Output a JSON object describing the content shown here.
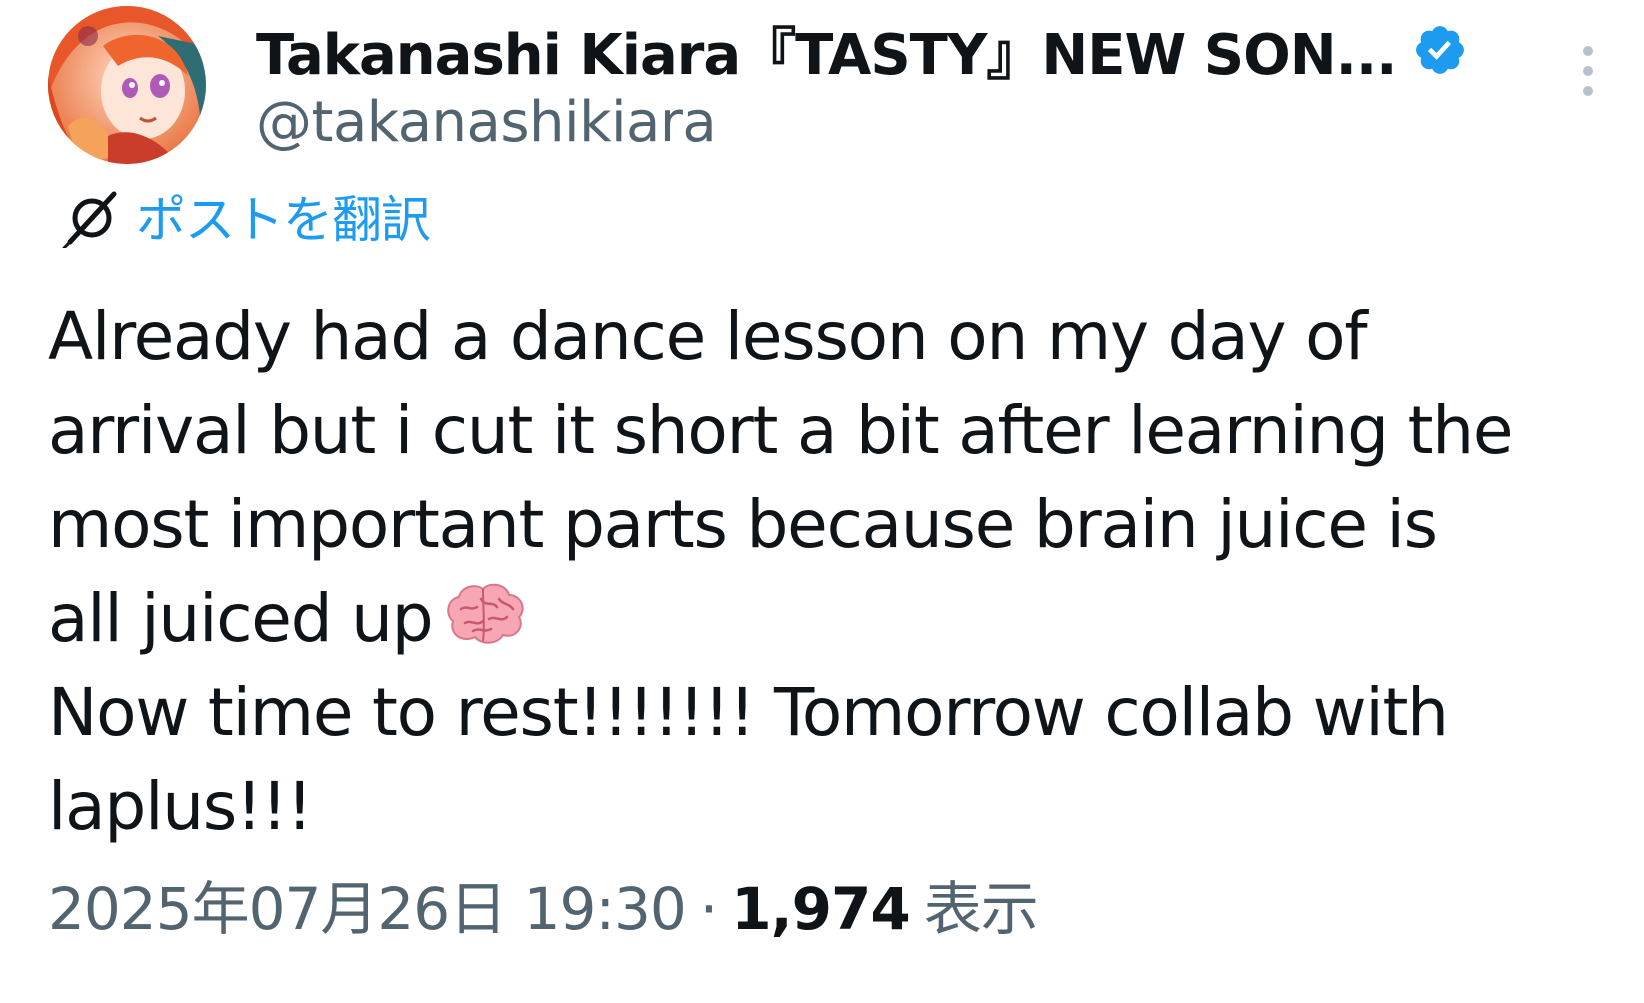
{
  "post": {
    "author": {
      "display_name": "Takanashi Kiara『TASTY』NEW SON...",
      "handle": "@takanashikiara",
      "verified_icon": "verified-badge-icon",
      "avatar": "avatar"
    },
    "more_icon": "more-vertical-icon",
    "translate": {
      "icon": "translate-icon",
      "label": "ポストを翻訳"
    },
    "body_lines": [
      "Already had a dance lesson on my day of",
      "arrival but i cut it short a bit after learning the",
      "most important parts because brain juice is",
      "all juiced up",
      "Now time to rest!!!!!!! Tomorrow collab with",
      "laplus!!!"
    ],
    "emoji": "brain-emoji-icon",
    "timestamp": "2025年07月26日 19:30",
    "separator": "·",
    "views_count": "1,974",
    "views_label": "表示"
  },
  "colors": {
    "text_primary": "#0f1419",
    "text_secondary": "#536471",
    "accent_blue": "#1d9bf0",
    "background": "#ffffff"
  }
}
